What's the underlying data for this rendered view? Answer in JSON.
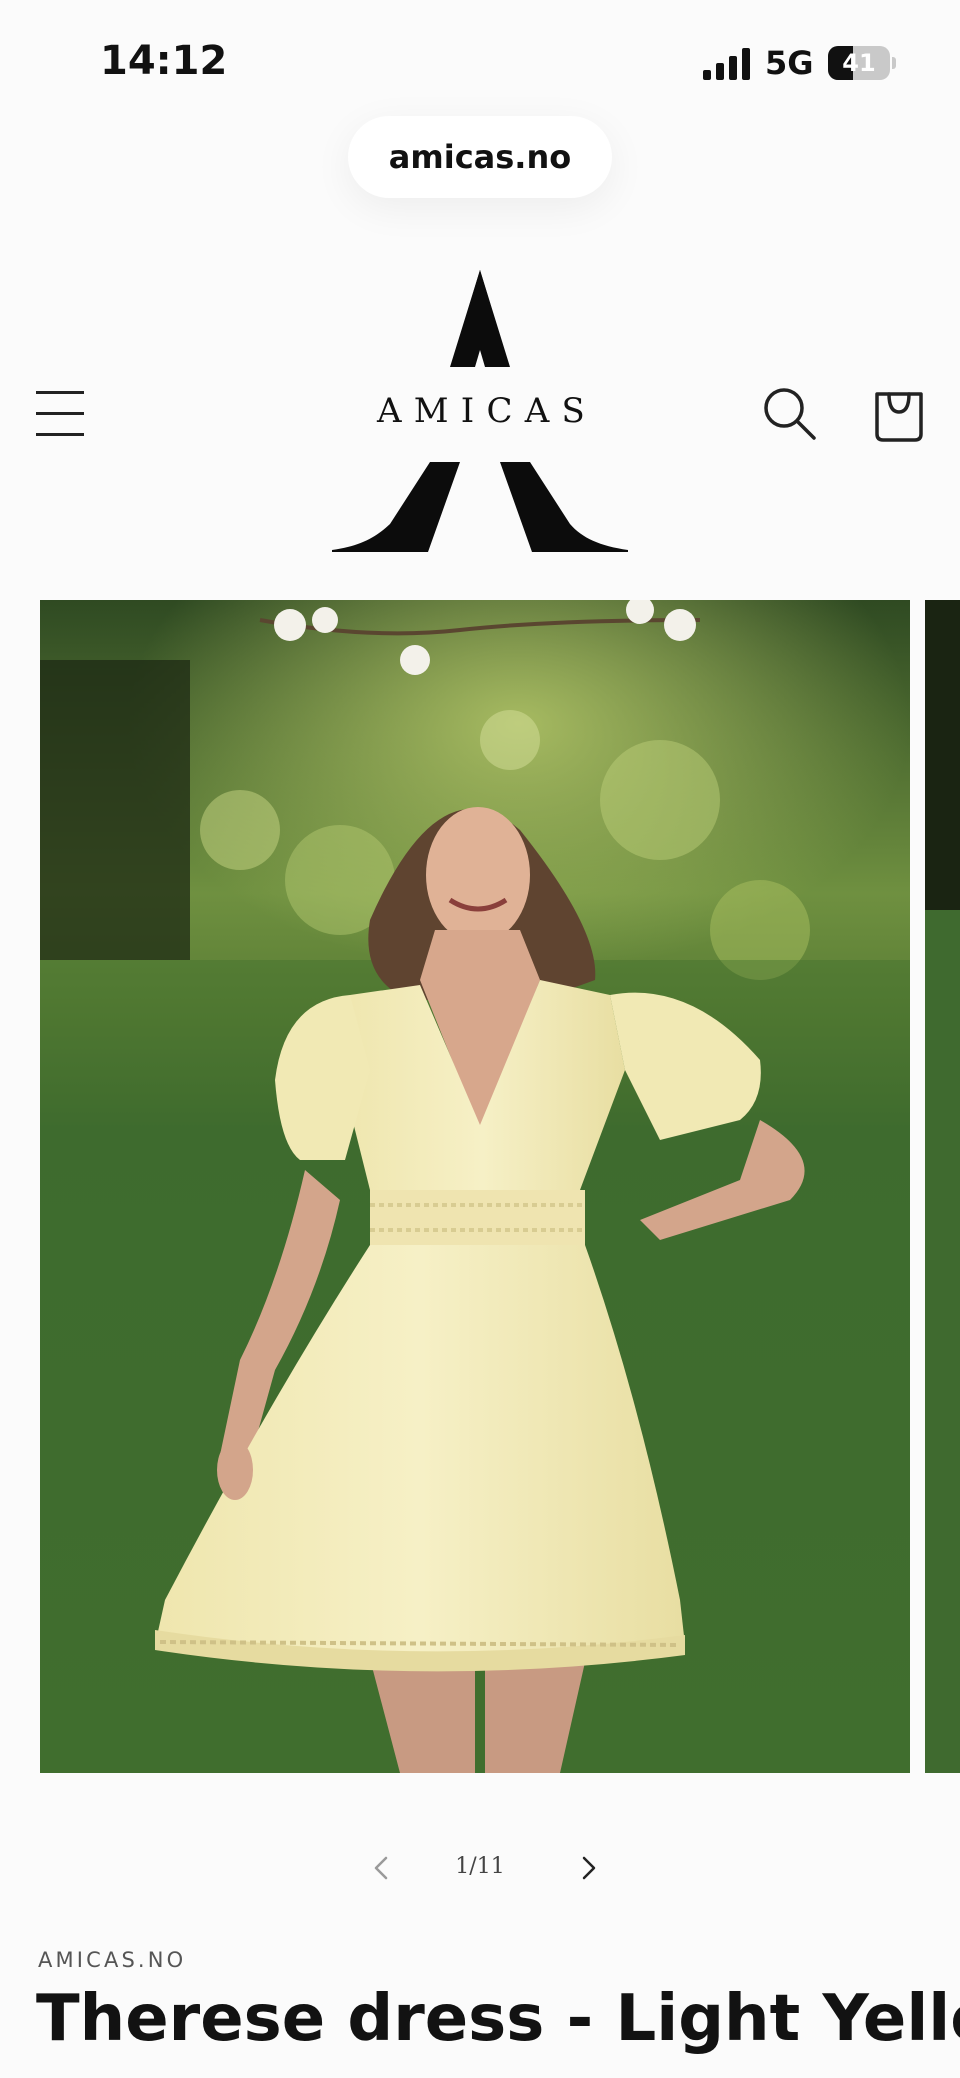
{
  "status_bar": {
    "time": "14:12",
    "network": "5G",
    "battery": "41",
    "battery_level": 0.41
  },
  "browser": {
    "url": "amicas.no"
  },
  "header": {
    "brand": "AMICAS",
    "menu_icon": "hamburger-menu-icon",
    "search_icon": "search-icon",
    "cart_icon": "shopping-bag-icon"
  },
  "gallery": {
    "counter": "1/11",
    "current": 1,
    "total": 11,
    "prev_icon": "chevron-left-icon",
    "next_icon": "chevron-right-icon"
  },
  "product": {
    "vendor": "AMICAS.NO",
    "title": "Therese dress - Light Yellow"
  },
  "colors": {
    "background": "#fbfbfb",
    "text": "#121212",
    "dress": "#f1ebb9",
    "grass": "#4a7a38"
  }
}
